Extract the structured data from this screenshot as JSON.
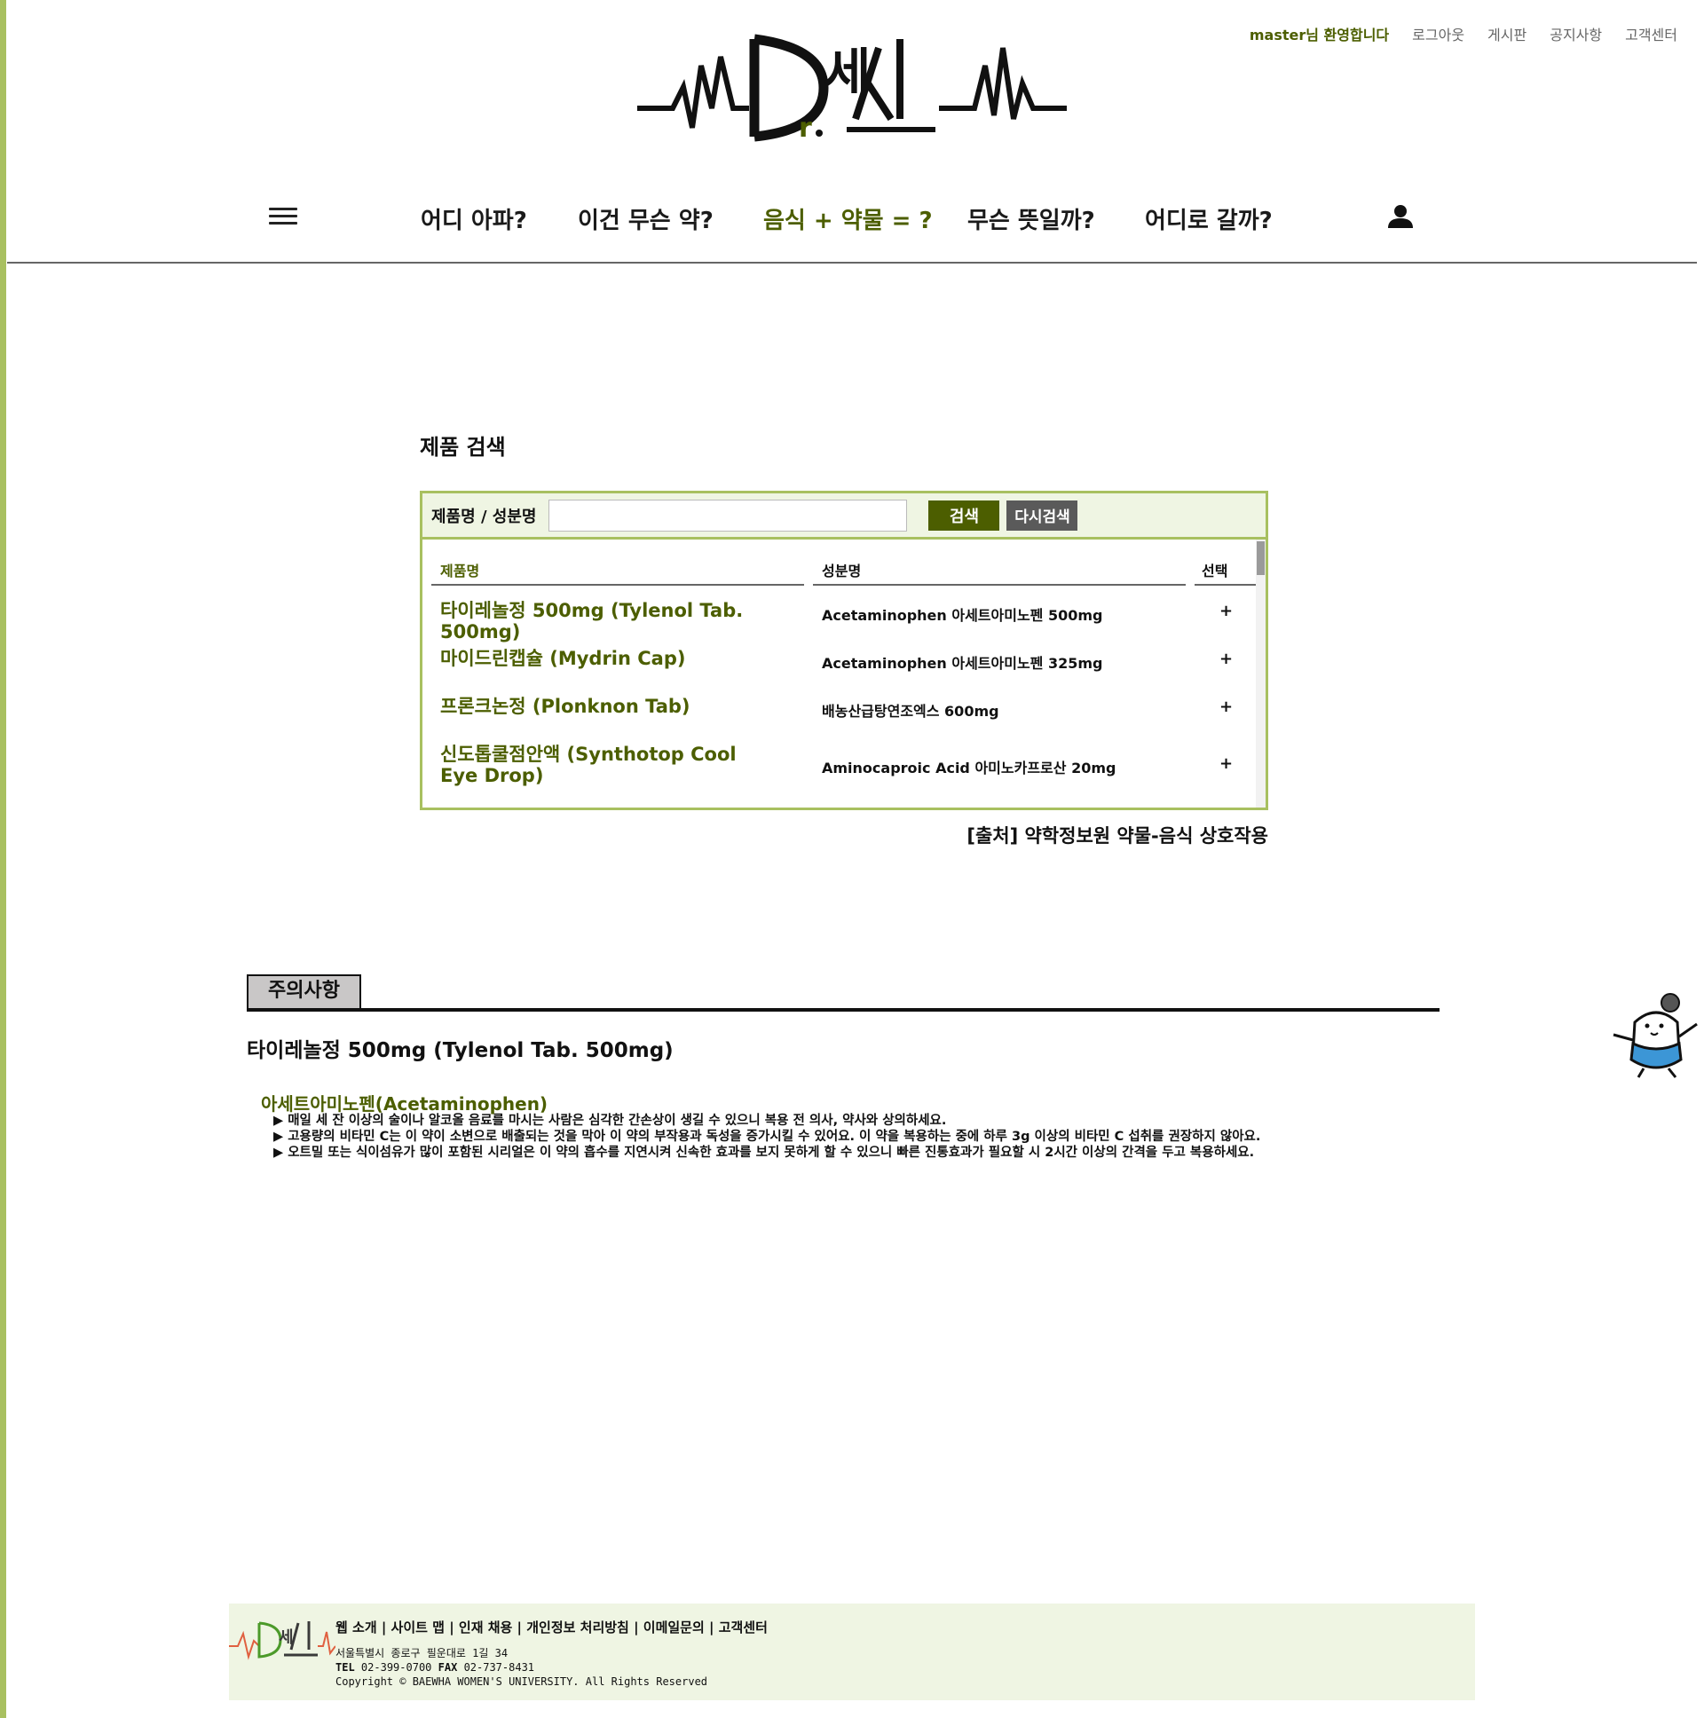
{
  "colors": {
    "accent": "#4c5e00",
    "light_green_border": "#a8c060",
    "left_bar": "#a8c060",
    "search_button": "#4c5e00",
    "reset_button": "#5a5a5a",
    "footer_bg": "#eff5e3",
    "mascot_blue": "#3c96d6"
  },
  "header": {
    "welcome": "master님 환영합니다",
    "logout": "로그아웃",
    "board": "게시판",
    "notice": "공지사항",
    "support": "고객센터",
    "logo_icon": "dr-logo-ecg"
  },
  "nav": {
    "menu_icon": "hamburger-icon",
    "items": [
      {
        "label": "어디 아파?"
      },
      {
        "label": "이건 무슨 약?"
      },
      {
        "label": "음식 + 약물 = ?"
      },
      {
        "label": "무슨 뜻일까?"
      },
      {
        "label": "어디로 갈까?"
      }
    ],
    "user_icon": "user-icon"
  },
  "search": {
    "title": "제품 검색",
    "field_label": "제품명 / 성분명",
    "input_value": "",
    "search_button": "검색",
    "reset_button": "다시검색",
    "columns": {
      "name": "제품명",
      "ingredient": "성분명",
      "select": "선택"
    },
    "rows": [
      {
        "name": "타이레놀정 500mg (Tylenol Tab. 500mg)",
        "ingredient": "Acetaminophen 아세트아미노펜 500mg",
        "select": "+"
      },
      {
        "name": "마이드린캡슐 (Mydrin Cap)",
        "ingredient": "Acetaminophen 아세트아미노펜 325mg",
        "select": "+"
      },
      {
        "name": "프론크논정 (Plonknon Tab)",
        "ingredient": "배농산급탕연조엑스 600mg",
        "select": "+"
      },
      {
        "name": "신도톱쿨점안액 (Synthotop Cool Eye Drop)",
        "ingredient": "Aminocaproic Acid 아미노카프로산 20mg",
        "select": "+"
      }
    ],
    "source": "[출처] 약학정보원 약물-음식 상호작용"
  },
  "caution": {
    "tab": "주의사항",
    "product": "타이레놀정 500mg (Tylenol Tab. 500mg)",
    "ingredient": "아세트아미노펜(Acetaminophen)",
    "lines": [
      "▶ 매일 세 잔 이상의 술이나 알코올 음료를 마시는 사람은 심각한 간손상이 생길 수 있으니 복용 전 의사, 약사와 상의하세요.",
      "▶ 고용량의 비타민 C는 이 약이 소변으로 배출되는 것을 막아 이 약의 부작용과 독성을 증가시킬 수 있어요. 이 약을 복용하는 중에 하루 3g 이상의 비타민 C 섭취를 권장하지 않아요.",
      "▶ 오트밀 또는 식이섬유가 많이 포함된 시리얼은 이 약의 흡수를 지연시켜 신속한 효과를 보지 못하게 할 수 있으니 빠른 진통효과가 필요할 시 2시간 이상의 간격을 두고 복용하세요."
    ]
  },
  "mascot_icon": "doctor-mascot-icon",
  "footer": {
    "links": "웹 소개 | 사이트 맵 | 인재 채용 | 개인정보 처리방침 | 이메일문의 | 고객센터",
    "address": "서울특별시 종로구 필운대로 1길 34",
    "tel_label": "TEL",
    "tel": "02-399-0700",
    "fax_label": "FAX",
    "fax": "02-737-8431",
    "copyright": "Copyright © BAEWHA WOMEN'S UNIVERSITY. All Rights Reserved"
  }
}
